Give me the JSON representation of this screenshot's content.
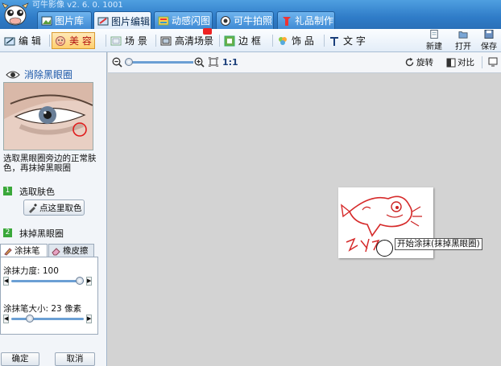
{
  "app": {
    "title": "可牛影像  v2. 6. 0. 1001"
  },
  "tabs": [
    {
      "label": "图片库",
      "icon": "photo-library-icon"
    },
    {
      "label": "图片编辑",
      "icon": "photo-edit-icon"
    },
    {
      "label": "动感闪图",
      "icon": "flash-image-icon"
    },
    {
      "label": "可牛拍照",
      "icon": "camera-icon"
    },
    {
      "label": "礼品制作",
      "icon": "gift-icon"
    }
  ],
  "toolbar": {
    "items": [
      {
        "label": "编 辑",
        "icon": "edit-icon"
      },
      {
        "label": "美 容",
        "icon": "beauty-icon"
      },
      {
        "label": "场 景",
        "icon": "scene-icon"
      },
      {
        "label": "高清场景",
        "icon": "hd-scene-icon"
      },
      {
        "label": "边 框",
        "icon": "frame-icon"
      },
      {
        "label": "饰 品",
        "icon": "accessory-icon"
      },
      {
        "label": "文 字",
        "icon": "text-icon"
      }
    ],
    "new_label": "新建",
    "open_label": "打开",
    "save_label": "保存",
    "active_color": "#b01010"
  },
  "panel": {
    "title": "消除黑眼圈",
    "hint": "选取黑眼圈旁边的正常肤色，再抹掉黑眼圈",
    "step1_num": "1",
    "step1_label": "选取肤色",
    "pick_button": "点这里取色",
    "step2_num": "2",
    "step2_label": "抹掉黑眼圈",
    "tab_brush": "涂抹笔",
    "tab_eraser": "橡皮擦",
    "strength_label": "涂抹力度: 100",
    "strength_value": 100,
    "size_label": "涂抹笔大小: 23 像素",
    "size_value": 23,
    "ok_label": "确定",
    "cancel_label": "取消"
  },
  "canvas": {
    "zoom_label": "1:1",
    "rotate_label": "旋转",
    "compare_label": "对比",
    "tooltip": "开始涂抹(抹掉黑眼圈)"
  }
}
